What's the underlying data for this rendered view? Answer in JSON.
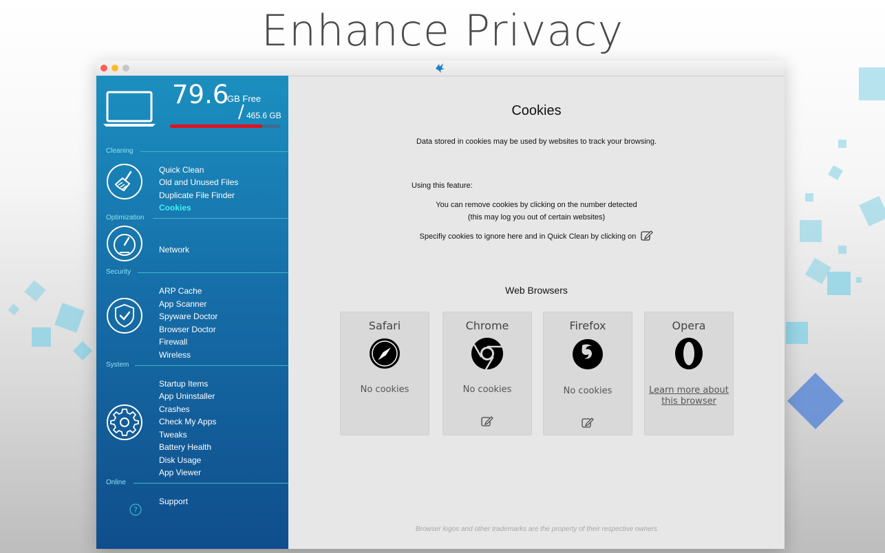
{
  "hero": {
    "title": "Enhance Privacy"
  },
  "disk": {
    "free_value": "79.6",
    "free_label": "GB Free",
    "slash": "/",
    "total": "465.6 GB",
    "used_fraction": 0.84
  },
  "sidebar": {
    "sections": {
      "cleaning": "Cleaning",
      "optimization": "Optimization",
      "security": "Security",
      "system": "System",
      "online": "Online"
    },
    "cleaning_items": [
      "Quick Clean",
      "Old and Unused Files",
      "Duplicate File Finder",
      "Cookies"
    ],
    "optimization_items": [
      "Network"
    ],
    "security_items": [
      "ARP Cache",
      "App Scanner",
      "Spyware Doctor",
      "Browser Doctor",
      "Firewall",
      "Wireless"
    ],
    "system_items": [
      "Startup Items",
      "App Uninstaller",
      "Crashes",
      "Check My Apps",
      "Tweaks",
      "Battery Health",
      "Disk Usage",
      "App Viewer"
    ],
    "online_items": [
      "Support"
    ]
  },
  "main": {
    "title": "Cookies",
    "description": "Data stored in cookies may be used by websites to track your browsing.",
    "using_label": "Using this feature:",
    "line1": "You can remove cookies by clicking on the number detected",
    "line2": "(this may log you out of certain websites)",
    "line3": "Specifiy cookies to ignore here and in Quick Clean by clicking on",
    "browsers_title": "Web Browsers",
    "browsers": [
      {
        "name": "Safari",
        "status": "No cookies",
        "icon": "compass-icon"
      },
      {
        "name": "Chrome",
        "status": "No cookies",
        "icon": "chrome-icon"
      },
      {
        "name": "Firefox",
        "status": "No cookies",
        "icon": "firefox-icon"
      },
      {
        "name": "Opera",
        "link_line1": "Learn more about",
        "link_line2": "this browser",
        "icon": "opera-icon"
      }
    ],
    "footer": "Browser logos and other trademarks are the property of their respective owners"
  },
  "colors": {
    "accent": "#3ff2f2",
    "disk_bar": "#e0111c",
    "sidebar_top": "#1b8fbf",
    "sidebar_bottom": "#0f4e8c"
  }
}
